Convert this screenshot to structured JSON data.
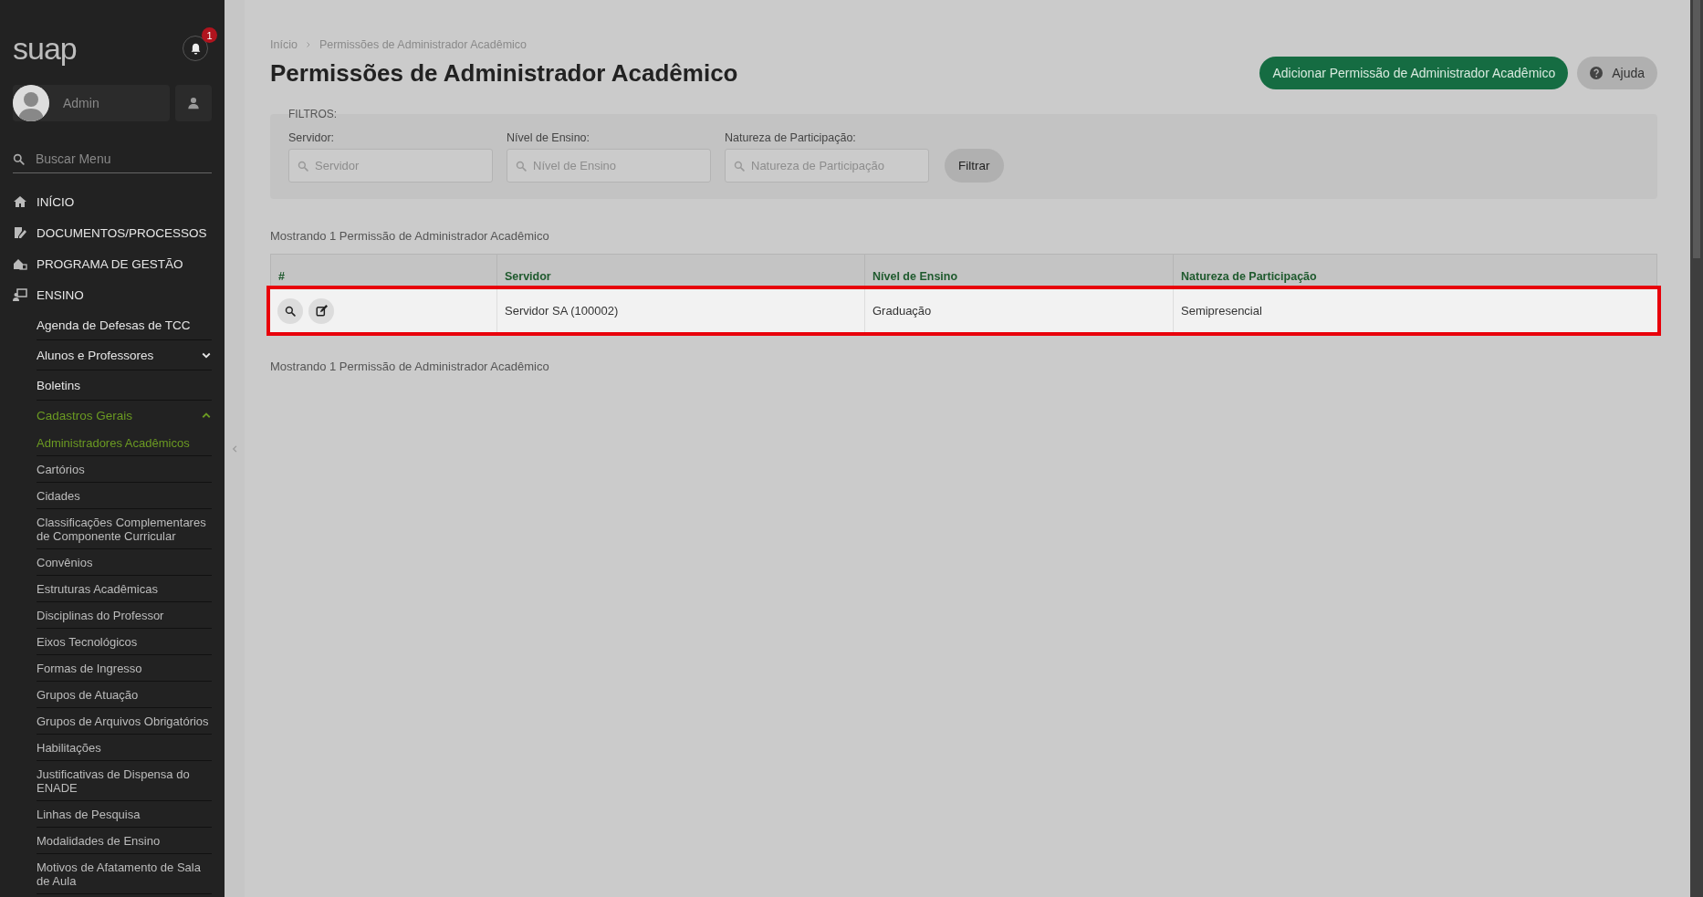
{
  "sidebar": {
    "logo": "suap",
    "notifications": {
      "count": "1"
    },
    "user": {
      "name": "Admin"
    },
    "search": {
      "placeholder": "Buscar Menu"
    },
    "menu": [
      {
        "label": "INÍCIO"
      },
      {
        "label": "DOCUMENTOS/PROCESSOS"
      },
      {
        "label": "PROGRAMA DE GESTÃO"
      },
      {
        "label": "ENSINO",
        "children": [
          {
            "label": "Agenda de Defesas de TCC",
            "kind": "link"
          },
          {
            "label": "Alunos e Professores",
            "kind": "group",
            "expanded": false
          },
          {
            "label": "Boletins",
            "kind": "link"
          },
          {
            "label": "Cadastros Gerais",
            "kind": "group",
            "expanded": true,
            "children": [
              {
                "label": "Administradores Acadêmicos",
                "selected": true
              },
              {
                "label": "Cartórios",
                "selected": false
              },
              {
                "label": "Cidades",
                "selected": false
              },
              {
                "label": "Classificações Complementares de Componente Curricular",
                "selected": false
              },
              {
                "label": "Convênios",
                "selected": false
              },
              {
                "label": "Estruturas Acadêmicas",
                "selected": false
              },
              {
                "label": "Disciplinas do Professor",
                "selected": false
              },
              {
                "label": "Eixos Tecnológicos",
                "selected": false
              },
              {
                "label": "Formas de Ingresso",
                "selected": false
              },
              {
                "label": "Grupos de Atuação",
                "selected": false
              },
              {
                "label": "Grupos de Arquivos Obrigatórios",
                "selected": false
              },
              {
                "label": "Habilitações",
                "selected": false
              },
              {
                "label": "Justificativas de Dispensa do ENADE",
                "selected": false
              },
              {
                "label": "Linhas de Pesquisa",
                "selected": false
              },
              {
                "label": "Modalidades de Ensino",
                "selected": false
              },
              {
                "label": "Motivos de Afatamento de Sala de Aula",
                "selected": false
              }
            ]
          }
        ]
      }
    ]
  },
  "breadcrumb": [
    {
      "label": "Início"
    },
    {
      "label": "Permissões de Administrador Acadêmico"
    }
  ],
  "title": "Permissões de Administrador Acadêmico",
  "actions": [
    {
      "label": "Adicionar Permissão de Administrador Acadêmico",
      "kind": "primary"
    },
    {
      "label": "Ajuda",
      "kind": "help"
    }
  ],
  "filters": {
    "legend": "FILTROS:",
    "fields": [
      {
        "label": "Servidor:",
        "placeholder": "Servidor"
      },
      {
        "label": "Nível de Ensino:",
        "placeholder": "Nível de Ensino"
      },
      {
        "label": "Natureza de Participação:",
        "placeholder": "Natureza de Participação"
      }
    ],
    "button": "Filtrar"
  },
  "summary_top": "Mostrando 1 Permissão de Administrador Acadêmico",
  "table": {
    "columns": [
      "#",
      "Servidor",
      "Nível de Ensino",
      "Natureza de Participação"
    ],
    "rows": [
      {
        "cells": [
          "",
          "Servidor SA (100002)",
          "Graduação",
          "Semipresencial"
        ],
        "highlighted": true
      }
    ]
  },
  "summary_bottom": "Mostrando 1 Permissão de Administrador Acadêmico"
}
